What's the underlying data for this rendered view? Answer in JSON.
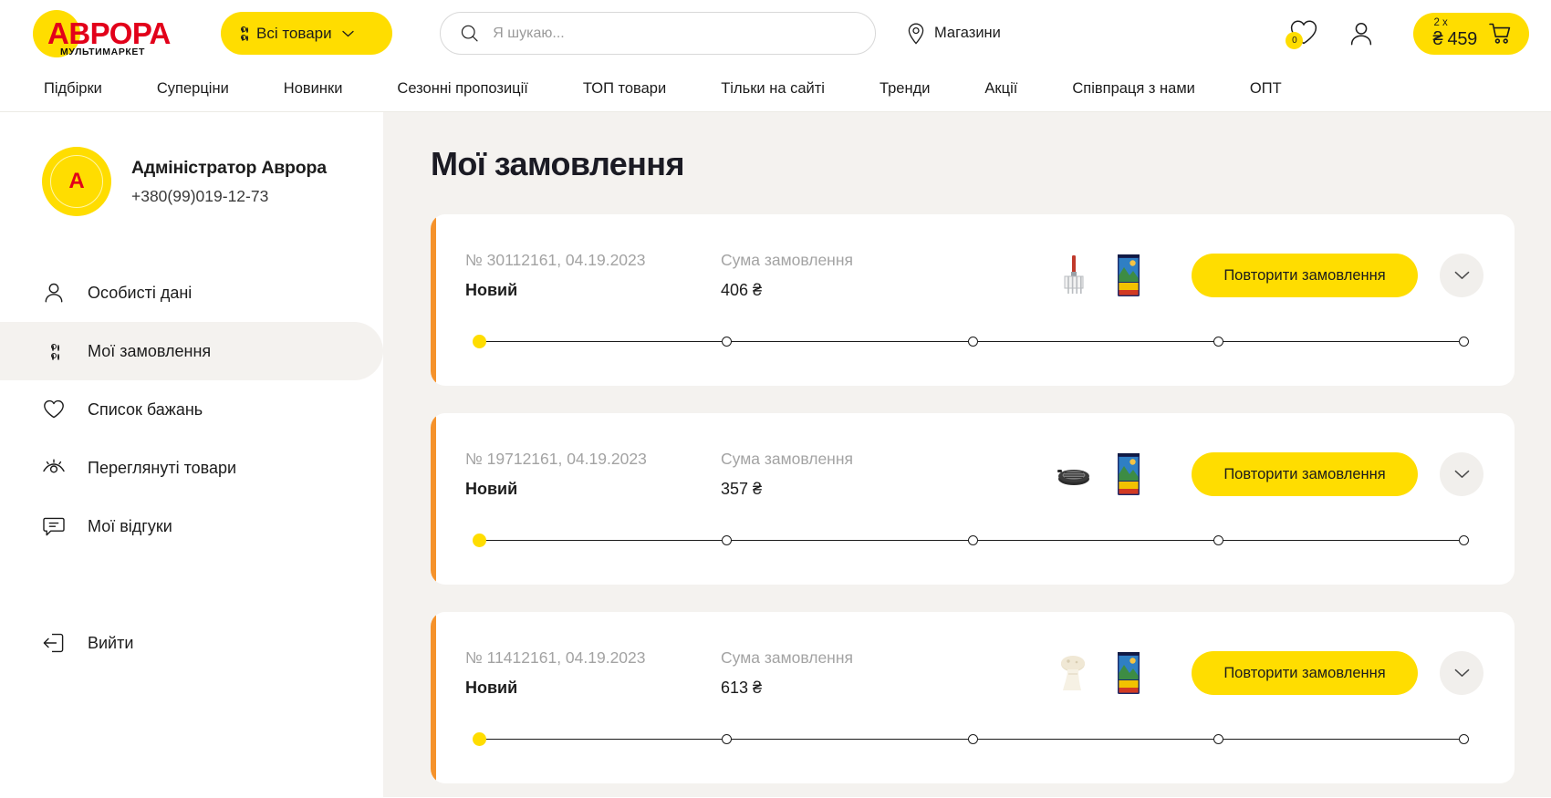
{
  "header": {
    "logo": {
      "word": "АВРОРА",
      "sub": "МУЛЬТИМАРКЕТ"
    },
    "all_goods_label": "Всі товари",
    "search": {
      "placeholder": "Я шукаю...",
      "value": ""
    },
    "stores_label": "Магазини",
    "favorites_count": "0",
    "cart": {
      "qty": "2 x",
      "sum": "₴ 459"
    }
  },
  "nav": {
    "items": [
      {
        "label": "Підбірки"
      },
      {
        "label": "Суперціни"
      },
      {
        "label": "Новинки"
      },
      {
        "label": "Сезонні пропозиції"
      },
      {
        "label": "ТОП товари"
      },
      {
        "label": "Тільки на сайті"
      },
      {
        "label": "Тренди"
      },
      {
        "label": "Акції"
      },
      {
        "label": "Співпраця з нами"
      },
      {
        "label": "ОПТ"
      }
    ]
  },
  "sidebar": {
    "profile": {
      "avatar_letter": "А",
      "name": "Адміністратор Аврора",
      "phone": "+380(99)019-12-73"
    },
    "items": [
      {
        "label": "Особисті дані",
        "icon": "user-icon",
        "active": false
      },
      {
        "label": "Мої замовлення",
        "icon": "grid-icon",
        "active": true
      },
      {
        "label": "Список бажань",
        "icon": "heart-icon",
        "active": false
      },
      {
        "label": "Переглянуті товари",
        "icon": "eye-icon",
        "active": false
      },
      {
        "label": "Мої відгуки",
        "icon": "comment-icon",
        "active": false
      }
    ],
    "logout": {
      "label": "Вийти",
      "icon": "logout-icon"
    }
  },
  "main": {
    "title": "Мої замовлення",
    "sum_label": "Сума замовлення",
    "repeat_label": "Повторити замовлення",
    "progress_steps": 5,
    "progress_current": 1,
    "orders": [
      {
        "number": "№ 30112161, 04.19.2023",
        "status": "Новий",
        "sum": "406 ₴",
        "thumbs": [
          "grill-brush",
          "charcoal-bag"
        ]
      },
      {
        "number": "№ 19712161, 04.19.2023",
        "status": "Новий",
        "sum": "357 ₴",
        "thumbs": [
          "grill-grate",
          "charcoal-bag"
        ]
      },
      {
        "number": "№ 11412161, 04.19.2023",
        "status": "Новий",
        "sum": "613 ₴",
        "thumbs": [
          "mushroom-decor",
          "charcoal-bag"
        ]
      }
    ]
  },
  "colors": {
    "brand_yellow": "#FFDD00",
    "brand_red": "#E2001A",
    "accent_orange": "#F5922B",
    "content_bg": "#f4f2ef"
  }
}
